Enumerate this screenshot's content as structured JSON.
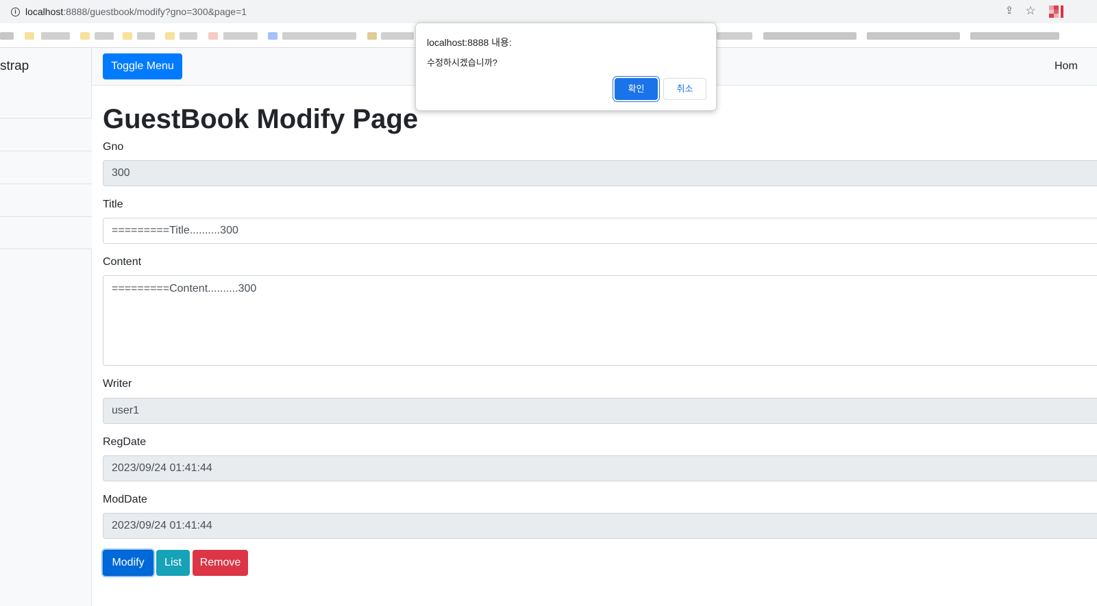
{
  "browser": {
    "url_host": "localhost",
    "url_rest": ":8888/guestbook/modify?gno=300&page=1",
    "info_icon": "info-icon",
    "share_icon": "share-icon",
    "star_icon": "star-icon"
  },
  "sidebar": {
    "heading": "strap",
    "item_count": 4
  },
  "topnav": {
    "toggle_label": "Toggle Menu",
    "home_label": "Hom"
  },
  "main": {
    "title": "GuestBook Modify Page",
    "fields": {
      "gno": {
        "label": "Gno",
        "value": "300"
      },
      "title": {
        "label": "Title",
        "value": "=========Title..........300"
      },
      "content": {
        "label": "Content",
        "value": "=========Content..........300"
      },
      "writer": {
        "label": "Writer",
        "value": "user1"
      },
      "regdate": {
        "label": "RegDate",
        "value": "2023/09/24 01:41:44"
      },
      "moddate": {
        "label": "ModDate",
        "value": "2023/09/24 01:41:44"
      }
    },
    "buttons": {
      "modify": "Modify",
      "list": "List",
      "remove": "Remove"
    }
  },
  "dialog": {
    "title": "localhost:8888 내용:",
    "message": "수정하시겠습니까?",
    "ok": "확인",
    "cancel": "취소"
  },
  "colors": {
    "primary": "#007bff",
    "info": "#17a2b8",
    "danger": "#dc3545",
    "chrome_blue": "#1a73e8"
  }
}
